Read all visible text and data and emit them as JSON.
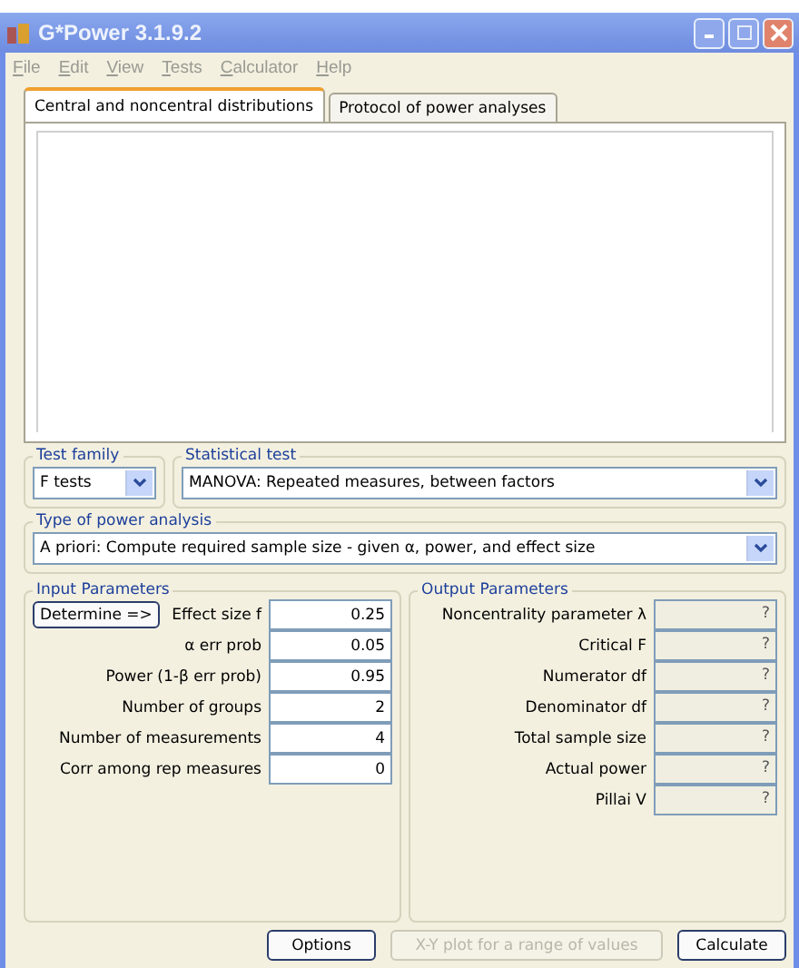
{
  "window": {
    "title": "G*Power 3.1.9.2"
  },
  "menu": [
    "File",
    "Edit",
    "View",
    "Tests",
    "Calculator",
    "Help"
  ],
  "tabs": [
    {
      "label": "Central and noncentral distributions",
      "selected": true
    },
    {
      "label": "Protocol of power analyses",
      "selected": false
    }
  ],
  "test_family": {
    "legend": "Test family",
    "value": "F tests"
  },
  "statistical_test": {
    "legend": "Statistical test",
    "value": "MANOVA: Repeated measures, between factors"
  },
  "type_of_power_analysis": {
    "legend": "Type of power analysis",
    "value": "A priori: Compute required sample size - given α, power, and effect size"
  },
  "input_parameters": {
    "legend": "Input Parameters",
    "determine_button": "Determine =>",
    "fields": [
      {
        "label": "Effect size f",
        "value": "0.25"
      },
      {
        "label": "α err prob",
        "value": "0.05"
      },
      {
        "label": "Power (1-β err prob)",
        "value": "0.95"
      },
      {
        "label": "Number of groups",
        "value": "2"
      },
      {
        "label": "Number of measurements",
        "value": "4"
      },
      {
        "label": "Corr among rep measures",
        "value": "0"
      }
    ]
  },
  "output_parameters": {
    "legend": "Output Parameters",
    "fields": [
      {
        "label": "Noncentrality parameter λ",
        "value": "?"
      },
      {
        "label": "Critical F",
        "value": "?"
      },
      {
        "label": "Numerator df",
        "value": "?"
      },
      {
        "label": "Denominator df",
        "value": "?"
      },
      {
        "label": "Total sample size",
        "value": "?"
      },
      {
        "label": "Actual power",
        "value": "?"
      },
      {
        "label": "Pillai V",
        "value": "?"
      }
    ]
  },
  "buttons": [
    {
      "label": "Options",
      "disabled": false
    },
    {
      "label": "X-Y plot for a range of values",
      "disabled": true
    },
    {
      "label": "Calculate",
      "disabled": false
    }
  ]
}
